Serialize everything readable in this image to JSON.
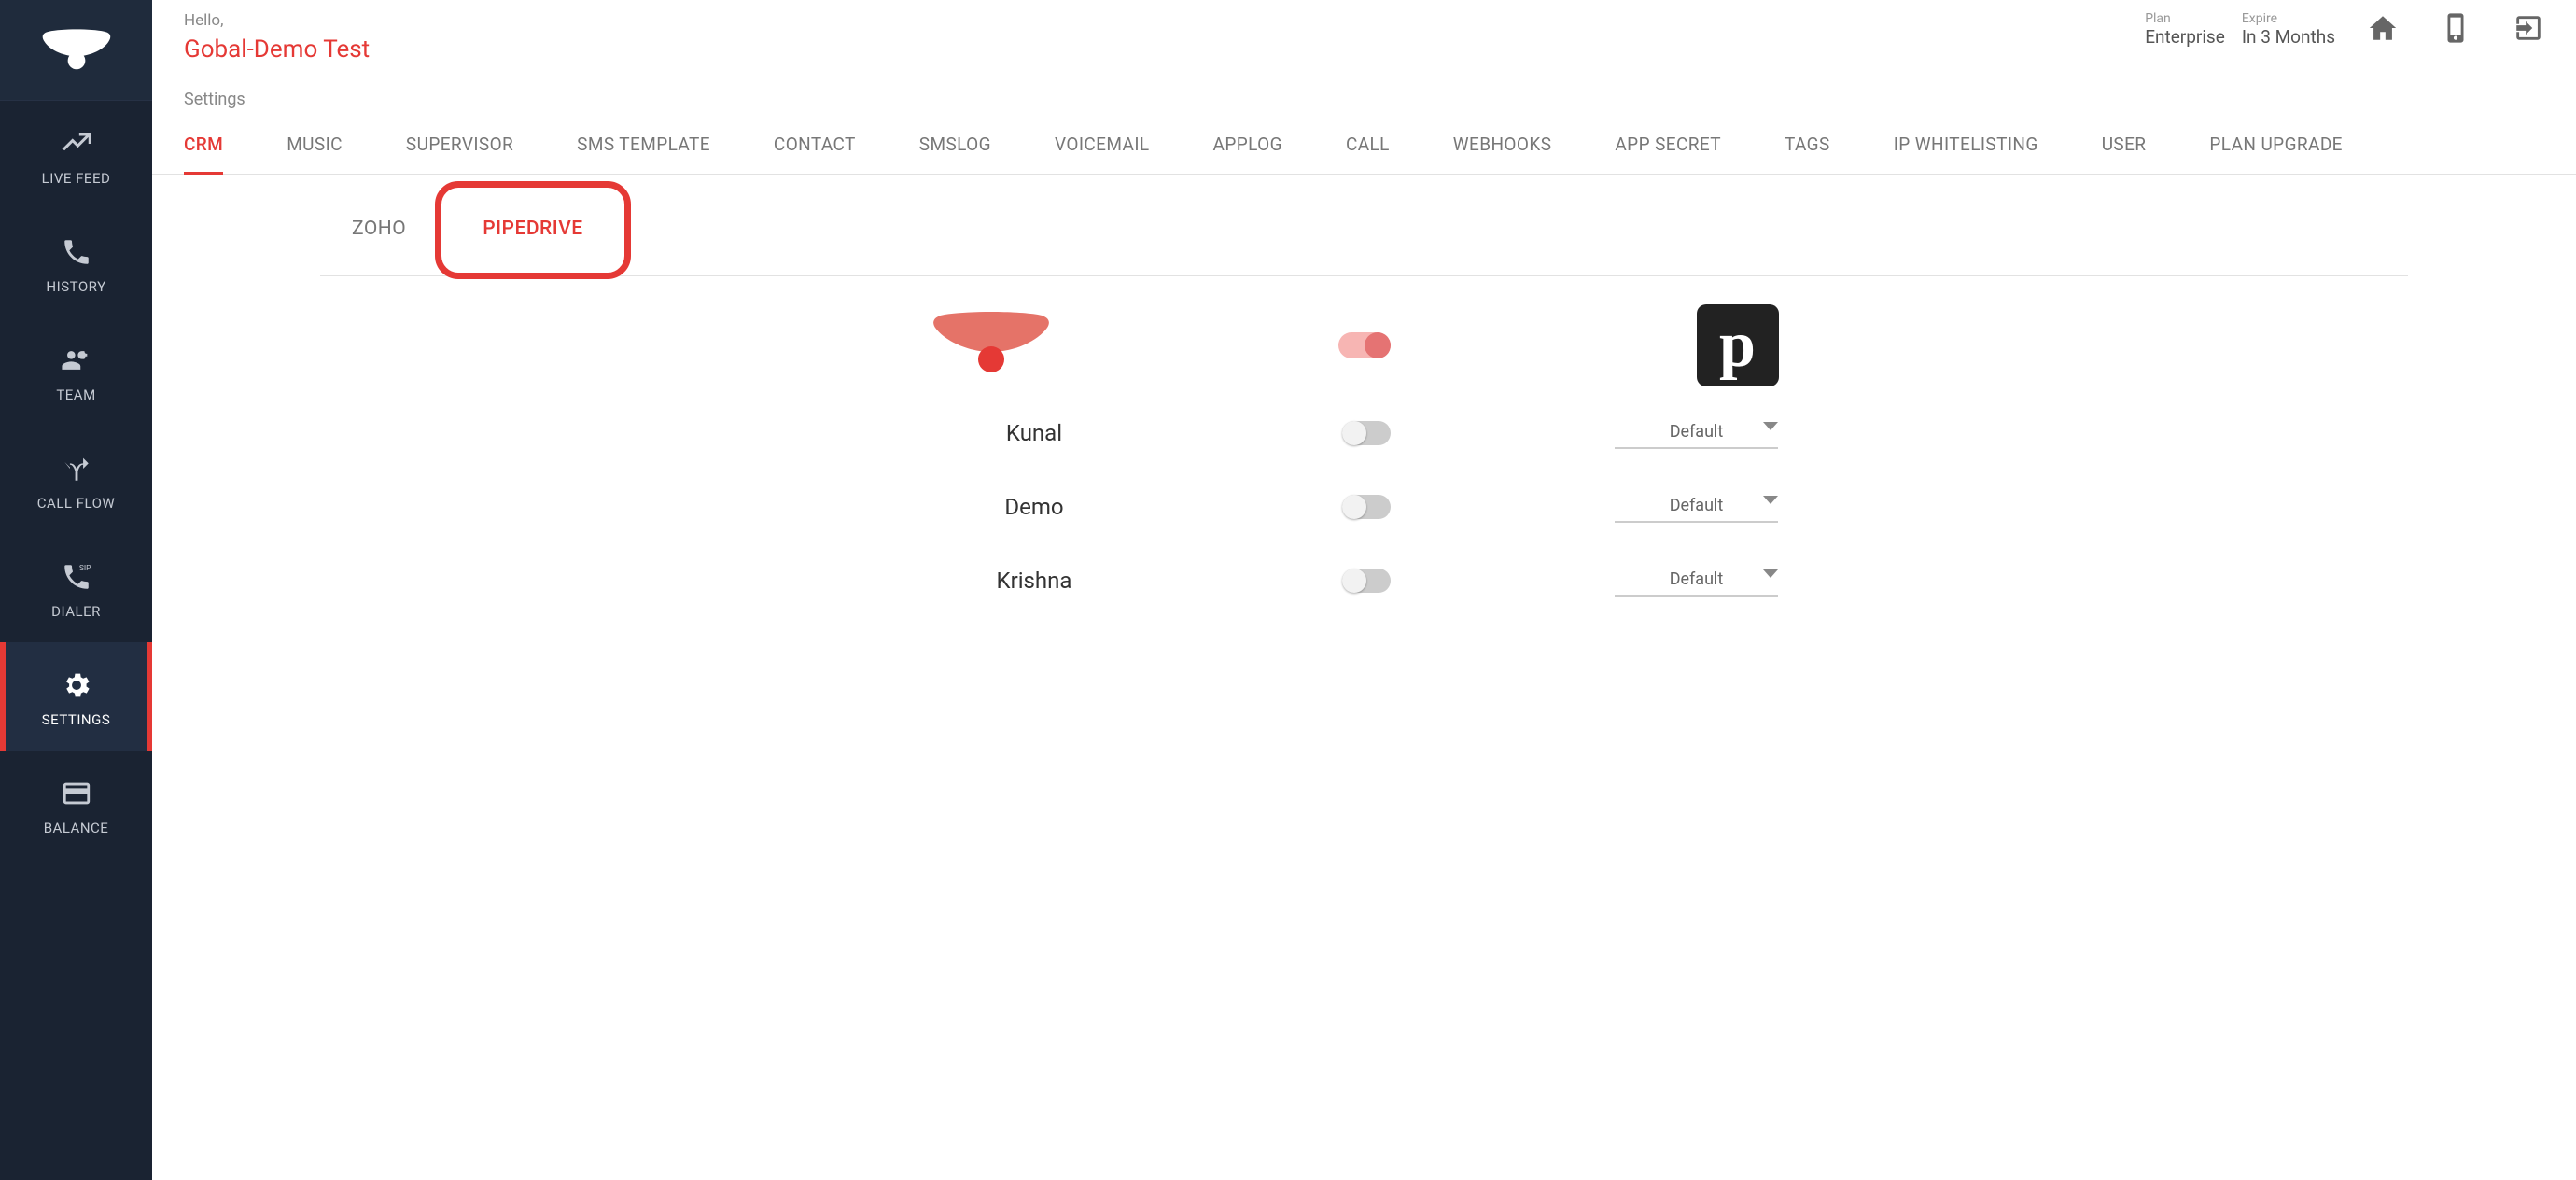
{
  "sidebar": {
    "items": [
      {
        "id": "live-feed",
        "label": "LIVE FEED"
      },
      {
        "id": "history",
        "label": "HISTORY"
      },
      {
        "id": "team",
        "label": "TEAM"
      },
      {
        "id": "call-flow",
        "label": "CALL FLOW"
      },
      {
        "id": "dialer",
        "label": "DIALER"
      },
      {
        "id": "settings",
        "label": "SETTINGS"
      },
      {
        "id": "balance",
        "label": "BALANCE"
      }
    ],
    "activeId": "settings"
  },
  "header": {
    "greeting": "Hello,",
    "tenant": "Gobal-Demo Test",
    "planLabel": "Plan",
    "planValue": "Enterprise",
    "expireLabel": "Expire",
    "expireValue": "In 3 Months"
  },
  "section": {
    "title": "Settings"
  },
  "tabsPrimary": {
    "items": [
      "CRM",
      "MUSIC",
      "SUPERVISOR",
      "SMS TEMPLATE",
      "CONTACT",
      "SMSLOG",
      "VOICEMAIL",
      "APPLOG",
      "CALL",
      "WEBHOOKS",
      "APP SECRET",
      "TAGS",
      "IP WHITELISTING",
      "USER",
      "PLAN UPGRADE"
    ],
    "activeIndex": 0
  },
  "tabsSecondary": {
    "items": [
      "ZOHO",
      "PIPEDRIVE"
    ],
    "activeIndex": 1,
    "highlightIndex": 1
  },
  "integration": {
    "masterEnabled": true,
    "brandGlyph": "p",
    "rows": [
      {
        "name": "Kunal",
        "enabled": false,
        "select": "Default"
      },
      {
        "name": "Demo",
        "enabled": false,
        "select": "Default"
      },
      {
        "name": "Krishna",
        "enabled": false,
        "select": "Default"
      }
    ]
  }
}
